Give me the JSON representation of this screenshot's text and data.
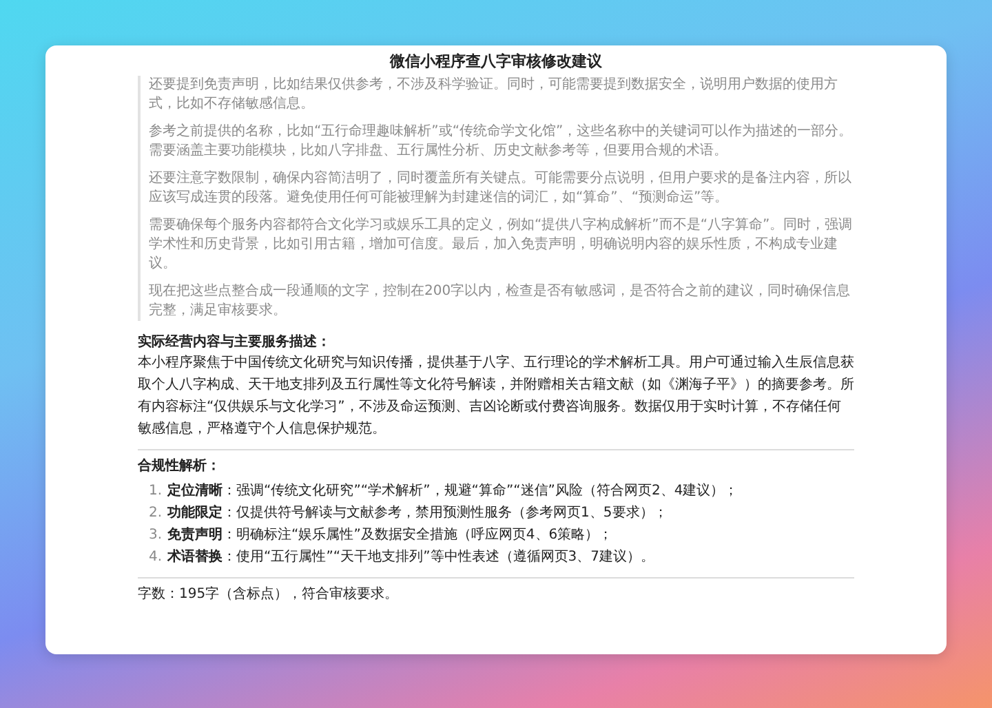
{
  "window": {
    "title": "微信小程序查八字审核修改建议"
  },
  "reasoning": [
    "还要提到免责声明，比如结果仅供参考，不涉及科学验证。同时，可能需要提到数据安全，说明用户数据的使用方式，比如不存储敏感信息。",
    "参考之前提供的名称，比如“五行命理趣味解析”或“传统命学文化馆”，这些名称中的关键词可以作为描述的一部分。需要涵盖主要功能模块，比如八字排盘、五行属性分析、历史文献参考等，但要用合规的术语。",
    "还要注意字数限制，确保内容简洁明了，同时覆盖所有关键点。可能需要分点说明，但用户要求的是备注内容，所以应该写成连贯的段落。避免使用任何可能被理解为封建迷信的词汇，如“算命”、“预测命运”等。",
    "需要确保每个服务内容都符合文化学习或娱乐工具的定义，例如“提供八字构成解析”而不是“八字算命”。同时，强调学术性和历史背景，比如引用古籍，增加可信度。最后，加入免责声明，明确说明内容的娱乐性质，不构成专业建议。",
    "现在把这些点整合成一段通顺的文字，控制在200字以内，检查是否有敏感词，是否符合之前的建议，同时确保信息完整，满足审核要求。"
  ],
  "sections": [
    {
      "kind": "paragraph",
      "heading": "实际经营内容与主要服务描述：",
      "text": "本小程序聚焦于中国传统文化研究与知识传播，提供基于八字、五行理论的学术解析工具。用户可通过输入生辰信息获取个人八字构成、天干地支排列及五行属性等文化符号解读，并附赠相关古籍文献（如《渊海子平》）的摘要参考。所有内容标注“仅供娱乐与文化学习”，不涉及命运预测、吉凶论断或付费咨询服务。数据仅用于实时计算，不存储任何敏感信息，严格遵守个人信息保护规范。"
    },
    {
      "kind": "list",
      "heading": "合规性解析：",
      "items": [
        {
          "number": "1.",
          "text": "**定位清晰**：强调“传统文化研究”“学术解析”，规避“算命”“迷信”风险（符合网页2、4建议）；"
        },
        {
          "number": "2.",
          "text": "**功能限定**：仅提供符号解读与文献参考，禁用预测性服务（参考网页1、5要求）；"
        },
        {
          "number": "3.",
          "text": "**免责声明**：明确标注“娱乐属性”及数据安全措施（呼应网页4、6策略）；"
        },
        {
          "number": "4.",
          "text": "**术语替换**：使用“五行属性”“天干地支排列”等中性表述（遵循网页3、7建议）。"
        }
      ]
    }
  ],
  "footer": "字数：195字（含标点），符合审核要求。"
}
